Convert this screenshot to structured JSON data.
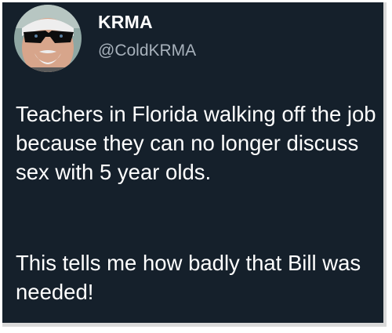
{
  "tweet": {
    "display_name": "KRMA",
    "handle": "@ColdKRMA",
    "paragraphs": [
      "Teachers in Florida walking off the job because they can no longer discuss sex with 5 year olds.",
      "This tells me how badly that Bill was needed!"
    ],
    "colors": {
      "background": "#15202b",
      "text": "#ffffff",
      "handle": "#a7b1bb"
    },
    "avatar_icon": "profile-photo"
  }
}
